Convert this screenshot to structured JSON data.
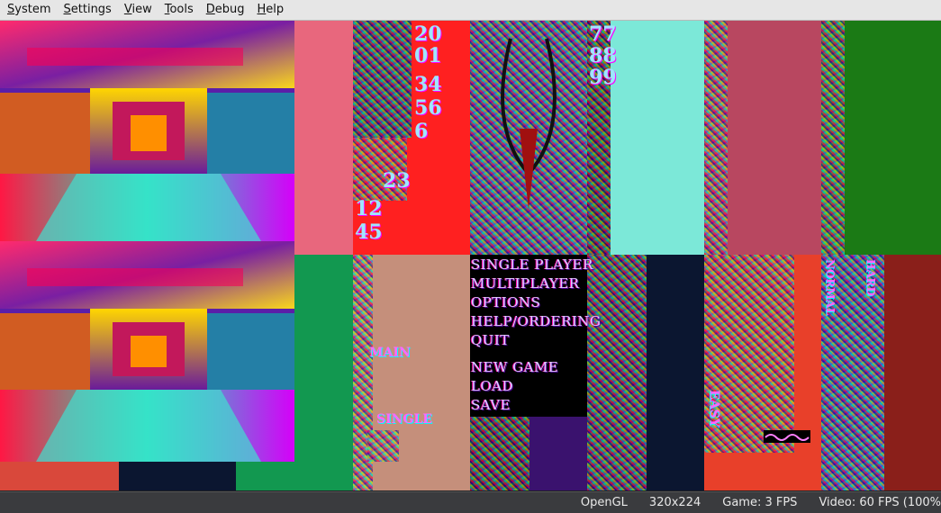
{
  "menu": [
    {
      "label": "System",
      "accel": "S",
      "rest": "ystem"
    },
    {
      "label": "Settings",
      "accel": "S",
      "rest": "ettings"
    },
    {
      "label": "View",
      "accel": "V",
      "rest": "iew"
    },
    {
      "label": "Tools",
      "accel": "T",
      "rest": "ools"
    },
    {
      "label": "Debug",
      "accel": "D",
      "rest": "ebug"
    },
    {
      "label": "Help",
      "accel": "H",
      "rest": "elp"
    }
  ],
  "game_menu": {
    "items": [
      "SINGLE PLAYER",
      "MULTIPLAYER",
      "OPTIONS",
      "HELP/ORDERING",
      "QUIT"
    ],
    "items2": [
      "NEW GAME",
      "LOAD",
      "SAVE"
    ]
  },
  "sprite_labels": {
    "n1": "20",
    "n2": "01",
    "n3": "34",
    "n4": "56",
    "n5": "6",
    "n6": "23",
    "n7": "12",
    "n8": "45",
    "n9": "77",
    "n10": "88",
    "n11": "99",
    "main": "MAIN",
    "single": "SINGLE",
    "easy": "EASY",
    "normal": "NORMAL",
    "hard": "HARD"
  },
  "status": {
    "renderer": "OpenGL",
    "resolution": "320x224",
    "game_fps": "Game: 3 FPS",
    "video_fps": "Video: 60 FPS (100%"
  }
}
